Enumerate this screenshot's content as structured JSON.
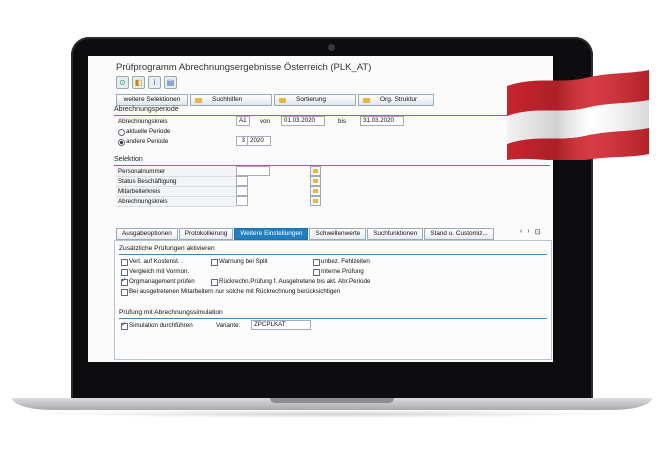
{
  "window": {
    "title": "Prüfprogramm Abrechnungsergebnisse Österreich (PLK_AT)"
  },
  "toolbar": {
    "icons": [
      "execute-icon",
      "variant-icon",
      "info-icon",
      "docs-icon"
    ]
  },
  "buttons": [
    {
      "label": "weitere Selektionen"
    },
    {
      "label": "Suchhilfen",
      "icon": "folder-icon"
    },
    {
      "label": "Sortierung",
      "icon": "folder-icon"
    },
    {
      "label": "Org. Struktur",
      "icon": "folder-icon"
    }
  ],
  "abrechnungsperiode": {
    "title": "Abrechnungsperiode",
    "kreis_label": "Abrechnungskreis",
    "kreis_value": "A1",
    "von_label": "von",
    "von_value": "01.03.2020",
    "bis_label": "bis",
    "bis_value": "31.03.2020",
    "aktuelle_label": "aktuelle Periode",
    "andere_label": "andere Periode",
    "andere_period": "3",
    "andere_year": "2020"
  },
  "selektion": {
    "title": "Selektion",
    "rows": [
      {
        "label": "Personalnummer"
      },
      {
        "label": "Status Beschäftigung"
      },
      {
        "label": "Mitarbeiterkreis"
      },
      {
        "label": "Abrechnungskreis"
      }
    ]
  },
  "tabs": [
    {
      "label": "Ausgabeoptionen"
    },
    {
      "label": "Protokollierung"
    },
    {
      "label": "Weitere Einstellungen",
      "active": true
    },
    {
      "label": "Schwellenwerte"
    },
    {
      "label": "Suchfunktionen"
    },
    {
      "label": "Stand u. Customiz..."
    }
  ],
  "tabnav": {
    "left": "‹",
    "right": "›",
    "menu": "⊡"
  },
  "zusaetzlich": {
    "title": "Zusätzliche Prüfungen aktivieren",
    "checks": [
      {
        "label": "Vert. auf Kostenst. .",
        "checked": false
      },
      {
        "label": "Warnung bei Split",
        "checked": false
      },
      {
        "label": "unbez. Fehlzeiten",
        "checked": false
      },
      {
        "label": "Vergleich mit Vormon.",
        "checked": false
      },
      {
        "label": "Interne Prüfung",
        "checked": false
      },
      {
        "label": "Orgmanagement prüfen",
        "checked": true
      },
      {
        "label": "Rückrechn.Prüfung f. Ausgetretene bis akt. Abr.Periode",
        "checked": false
      },
      {
        "label": "Bei ausgetretenen Mitarbeitern nur solche mit Rückrechnung berücksichtigen",
        "checked": false
      }
    ]
  },
  "simulation": {
    "title": "Prüfung mit Abrechnungssimulation",
    "check_label": "Simulation durchführen",
    "checked": true,
    "variante_label": "Variante:",
    "variante_value": "ZPCPLKAT"
  },
  "colors": {
    "accent": "#1f7fc0",
    "flag_red": "#d22630",
    "flag_white": "#ffffff"
  }
}
